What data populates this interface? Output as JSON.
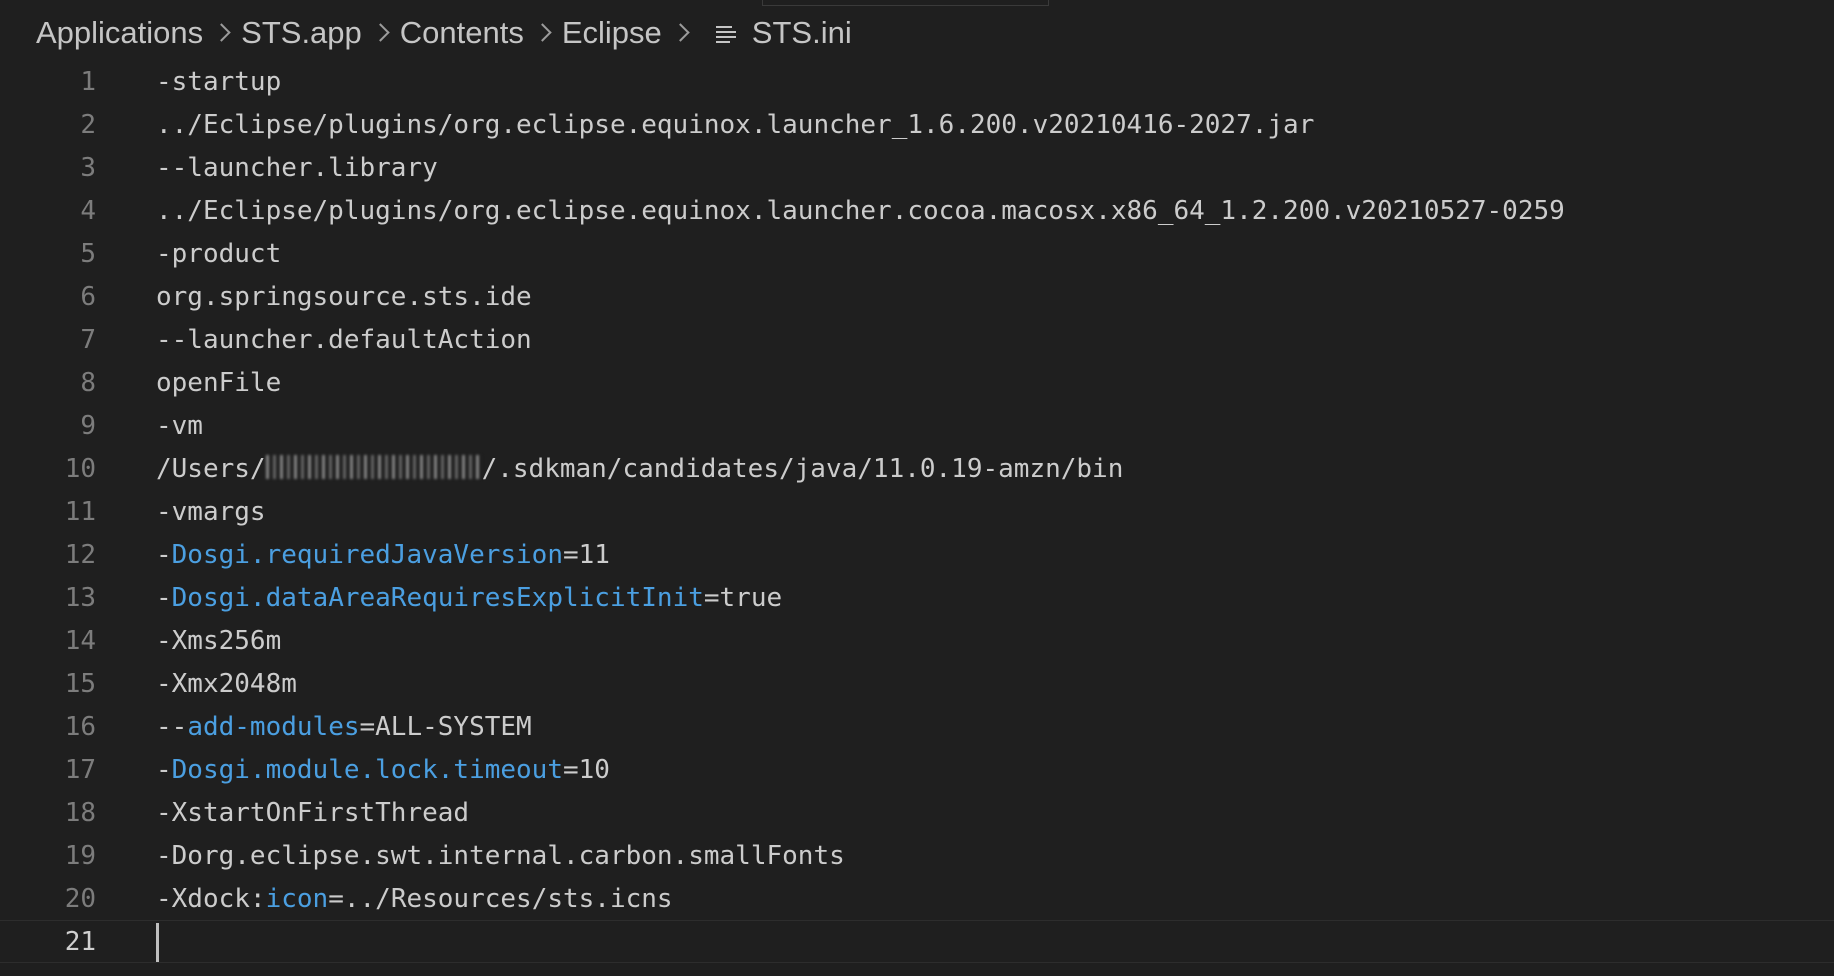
{
  "breadcrumb": {
    "items": [
      {
        "label": "Applications"
      },
      {
        "label": "STS.app"
      },
      {
        "label": "Contents"
      },
      {
        "label": "Eclipse"
      }
    ],
    "file_icon": "lines-file-icon",
    "file_name": "STS.ini"
  },
  "editor": {
    "current_line": 21,
    "lines": [
      {
        "number": "1",
        "text": "-startup"
      },
      {
        "number": "2",
        "text": "../Eclipse/plugins/org.eclipse.equinox.launcher_1.6.200.v20210416-2027.jar"
      },
      {
        "number": "3",
        "text": "--launcher.library"
      },
      {
        "number": "4",
        "text": "../Eclipse/plugins/org.eclipse.equinox.launcher.cocoa.macosx.x86_64_1.2.200.v20210527-0259"
      },
      {
        "number": "5",
        "text": "-product"
      },
      {
        "number": "6",
        "text": "org.springsource.sts.ide"
      },
      {
        "number": "7",
        "text": "--launcher.defaultAction"
      },
      {
        "number": "8",
        "text": "openFile"
      },
      {
        "number": "9",
        "text": "-vm"
      },
      {
        "number": "10",
        "prefix": "/Users/",
        "suffix": "/.sdkman/candidates/java/11.0.19-amzn/bin"
      },
      {
        "number": "11",
        "text": "-vmargs"
      },
      {
        "number": "12",
        "prefix": "-",
        "key": "Dosgi.requiredJavaVersion",
        "suffix": "=11"
      },
      {
        "number": "13",
        "prefix": "-",
        "key": "Dosgi.dataAreaRequiresExplicitInit",
        "suffix": "=true"
      },
      {
        "number": "14",
        "text": "-Xms256m"
      },
      {
        "number": "15",
        "text": "-Xmx2048m"
      },
      {
        "number": "16",
        "prefix": "--",
        "key": "add-modules",
        "suffix": "=ALL-SYSTEM"
      },
      {
        "number": "17",
        "prefix": "-",
        "key": "Dosgi.module.lock.timeout",
        "suffix": "=10"
      },
      {
        "number": "18",
        "text": "-XstartOnFirstThread"
      },
      {
        "number": "19",
        "text": "-Dorg.eclipse.swt.internal.carbon.smallFonts"
      },
      {
        "number": "20",
        "prefix": "-Xdock:",
        "key": "icon",
        "suffix": "=../Resources/sts.icns"
      },
      {
        "number": "21",
        "text": ""
      }
    ]
  },
  "colors": {
    "background": "#1f1f1f",
    "text": "#cccccc",
    "line_number": "#7c7c7c",
    "key": "#4b9fe1"
  }
}
